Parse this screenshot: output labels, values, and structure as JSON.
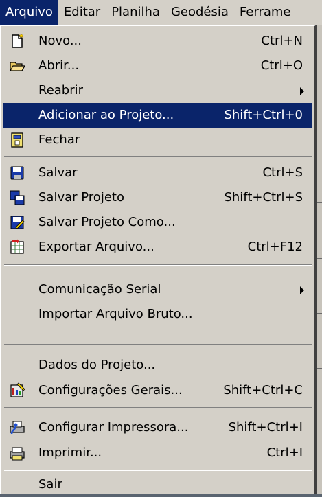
{
  "menubar": {
    "items": [
      "Arquivo",
      "Editar",
      "Planilha",
      "Geodésia",
      "Ferrame"
    ],
    "active": "Arquivo"
  },
  "menu": {
    "items": [
      {
        "label": "Novo...",
        "shortcut": "Ctrl+N",
        "icon": "new-document-icon"
      },
      {
        "label": "Abrir...",
        "shortcut": "Ctrl+O",
        "icon": "open-folder-icon"
      },
      {
        "label": "Reabrir",
        "shortcut": "",
        "icon": "",
        "submenu": true
      },
      {
        "label": "Adicionar ao Projeto...",
        "shortcut": "Shift+Ctrl+0",
        "icon": "",
        "highlighted": true
      },
      {
        "label": "Fechar",
        "shortcut": "",
        "icon": "close-file-icon"
      },
      {
        "label": "Salvar",
        "shortcut": "Ctrl+S",
        "icon": "save-disk-icon"
      },
      {
        "label": "Salvar Projeto",
        "shortcut": "Shift+Ctrl+S",
        "icon": "save-project-icon"
      },
      {
        "label": "Salvar Projeto Como...",
        "shortcut": "",
        "icon": "save-project-as-icon"
      },
      {
        "label": "Exportar Arquivo...",
        "shortcut": "Ctrl+F12",
        "icon": "export-file-icon"
      },
      {
        "label": "Comunicação Serial",
        "shortcut": "",
        "icon": "",
        "submenu": true
      },
      {
        "label": "Importar Arquivo Bruto...",
        "shortcut": "",
        "icon": ""
      },
      {
        "label": "Dados do Projeto...",
        "shortcut": "",
        "icon": ""
      },
      {
        "label": "Configurações Gerais...",
        "shortcut": "Shift+Ctrl+C",
        "icon": "general-settings-icon"
      },
      {
        "label": "Configurar Impressora...",
        "shortcut": "Shift+Ctrl+I",
        "icon": "printer-setup-icon"
      },
      {
        "label": "Imprimir...",
        "shortcut": "Ctrl+I",
        "icon": "print-icon"
      },
      {
        "label": "Sair",
        "shortcut": "",
        "icon": ""
      }
    ]
  },
  "colors": {
    "highlight": "#0a246a",
    "menu_bg": "#d4d0c8",
    "highlight_text": "#ffffff"
  }
}
